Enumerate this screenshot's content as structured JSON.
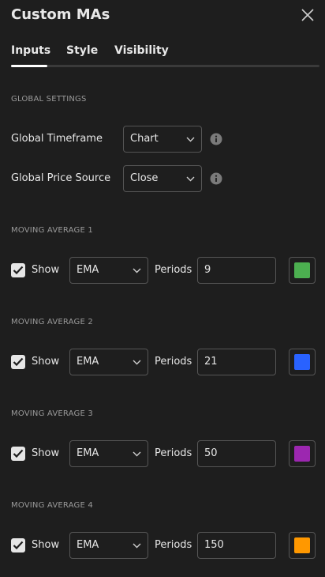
{
  "dialog": {
    "title": "Custom MAs"
  },
  "tabs": [
    {
      "label": "Inputs"
    },
    {
      "label": "Style"
    },
    {
      "label": "Visibility"
    }
  ],
  "global": {
    "section_title": "GLOBAL SETTINGS",
    "timeframe": {
      "label": "Global Timeframe",
      "value": "Chart"
    },
    "price_source": {
      "label": "Global Price Source",
      "value": "Close"
    }
  },
  "moving_averages": [
    {
      "section_title": "MOVING AVERAGE 1",
      "show_label": "Show",
      "type": "EMA",
      "periods_label": "Periods",
      "periods": "9",
      "color": "#4caf50"
    },
    {
      "section_title": "MOVING AVERAGE 2",
      "show_label": "Show",
      "type": "EMA",
      "periods_label": "Periods",
      "periods": "21",
      "color": "#2962ff"
    },
    {
      "section_title": "MOVING AVERAGE 3",
      "show_label": "Show",
      "type": "EMA",
      "periods_label": "Periods",
      "periods": "50",
      "color": "#9c27b0"
    },
    {
      "section_title": "MOVING AVERAGE 4",
      "show_label": "Show",
      "type": "EMA",
      "periods_label": "Periods",
      "periods": "150",
      "color": "#ff9800"
    }
  ]
}
